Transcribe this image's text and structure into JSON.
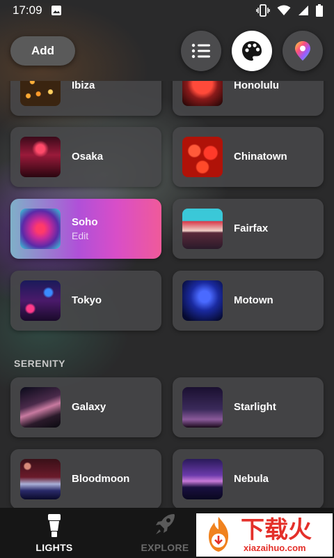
{
  "status_bar": {
    "time": "17:09"
  },
  "header": {
    "add_label": "Add"
  },
  "scenes": [
    {
      "label": "Ibiza"
    },
    {
      "label": "Honolulu"
    },
    {
      "label": "Osaka"
    },
    {
      "label": "Chinatown"
    },
    {
      "label": "Soho",
      "sublabel": "Edit",
      "selected": true
    },
    {
      "label": "Fairfax"
    },
    {
      "label": "Tokyo"
    },
    {
      "label": "Motown"
    }
  ],
  "sections": [
    {
      "title": "SERENITY",
      "scenes": [
        {
          "label": "Galaxy"
        },
        {
          "label": "Starlight"
        },
        {
          "label": "Bloodmoon"
        },
        {
          "label": "Nebula"
        }
      ]
    }
  ],
  "bottom_nav": {
    "items": [
      {
        "label": "LIGHTS",
        "icon": "bulb-icon",
        "active": true
      },
      {
        "label": "EXPLORE",
        "icon": "rocket-icon",
        "active": false
      }
    ]
  },
  "watermark": {
    "title": "下载火",
    "url": "xiazaihuo.com"
  },
  "colors": {
    "selected_gradient_start": "#7fb0c8",
    "selected_gradient_end": "#f05a9a",
    "background": "#2a2a2b",
    "nav_background": "#161616"
  }
}
